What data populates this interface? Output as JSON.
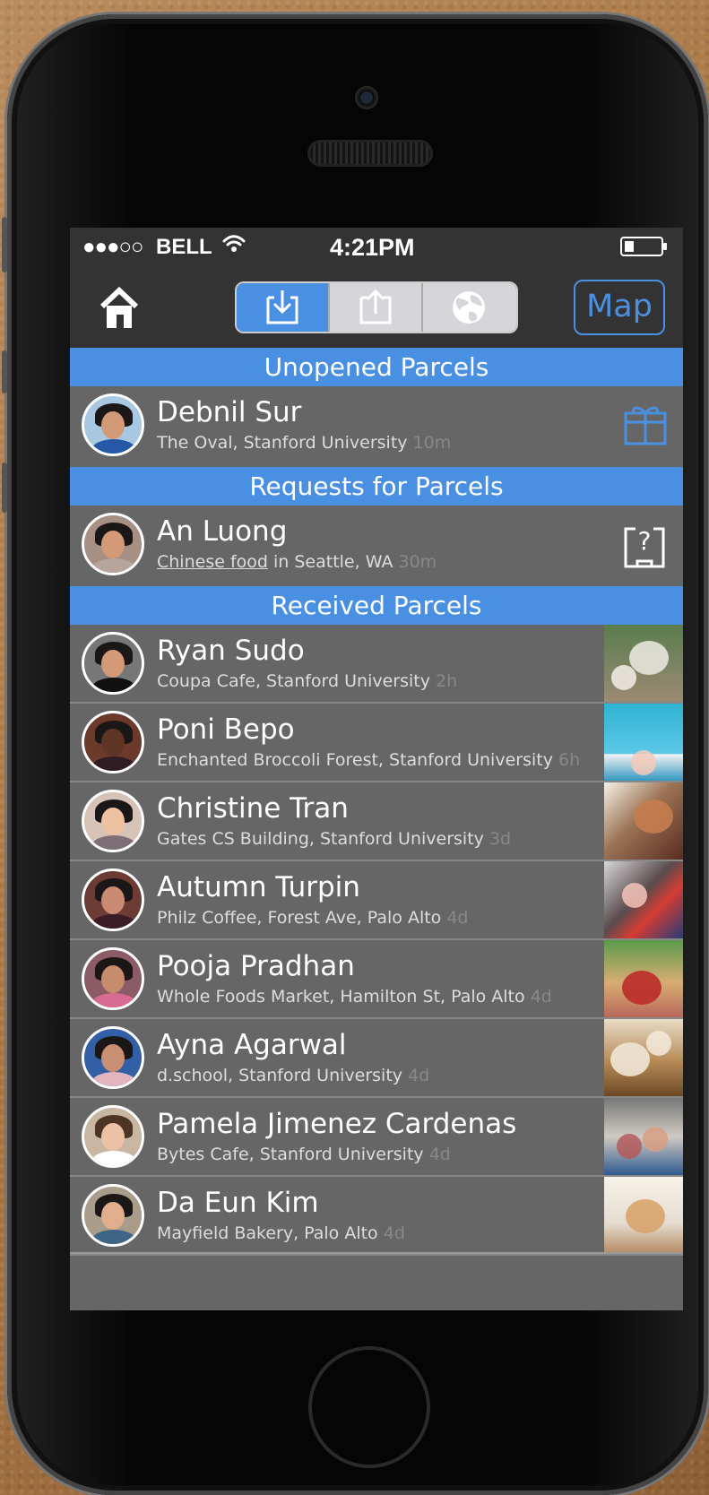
{
  "status_bar": {
    "signal": "●●●○○",
    "carrier": "BELL",
    "time": "4:21PM"
  },
  "navigation": {
    "segments": [
      "inbox-download-icon",
      "outbox-upload-icon",
      "globe-icon"
    ],
    "selected_segment": "inbox-download-icon",
    "map_label": "Map"
  },
  "sections": {
    "unopened": "Unopened Parcels",
    "requests": "Requests for Parcels",
    "received": "Received Parcels"
  },
  "unopened_parcels": [
    {
      "name": "Debnil Sur",
      "location": "The Oval, Stanford University",
      "time": "10m"
    }
  ],
  "requests": [
    {
      "name": "An Luong",
      "request": "Chinese food",
      "location": "in Seattle, WA",
      "time": "30m"
    }
  ],
  "received_parcels": [
    {
      "name": "Ryan Sudo",
      "location": "Coupa Cafe, Stanford University",
      "time": "2h"
    },
    {
      "name": "Poni Bepo",
      "location": "Enchanted Broccoli Forest, Stanford University",
      "time": "6h"
    },
    {
      "name": "Christine Tran",
      "location": "Gates CS Building, Stanford University",
      "time": "3d"
    },
    {
      "name": "Autumn Turpin",
      "location": "Philz Coffee, Forest Ave, Palo Alto",
      "time": "4d"
    },
    {
      "name": "Pooja Pradhan",
      "location": "Whole Foods Market, Hamilton St, Palo Alto",
      "time": "4d"
    },
    {
      "name": "Ayna Agarwal",
      "location": "d.school, Stanford University",
      "time": "4d"
    },
    {
      "name": "Pamela Jimenez Cardenas",
      "location": "Bytes Cafe, Stanford University",
      "time": "4d"
    },
    {
      "name": "Da Eun Kim",
      "location": "Mayfield Bakery, Palo Alto",
      "time": "4d"
    }
  ],
  "colors": {
    "accent": "#4a90e2",
    "row_background": "#666666",
    "bar_background": "#333333"
  }
}
